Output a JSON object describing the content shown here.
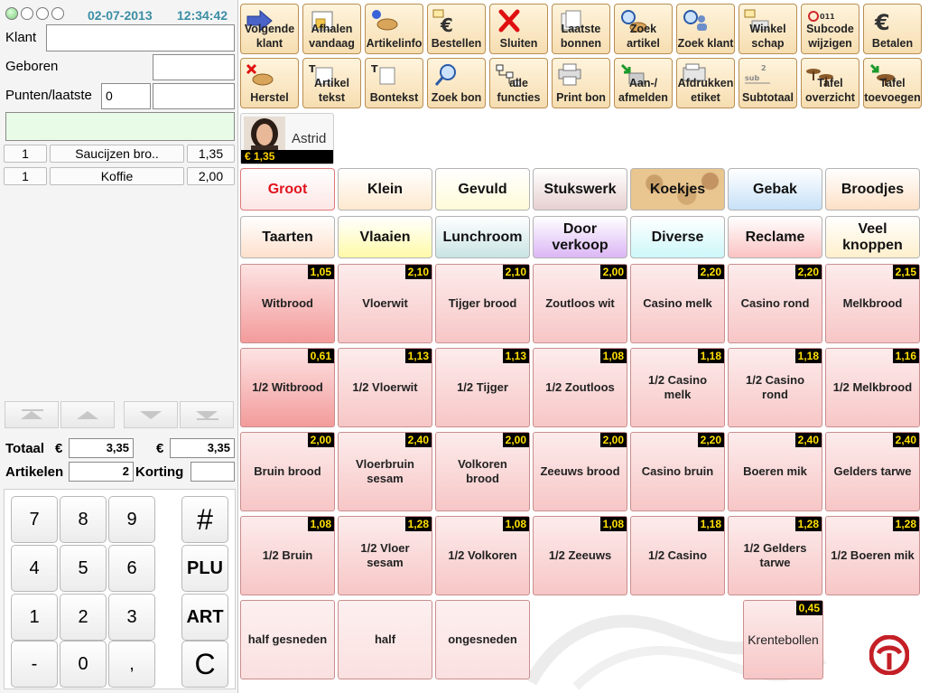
{
  "header": {
    "date": "02-07-2013",
    "time": "12:34:42"
  },
  "customer": {
    "klant_label": "Klant",
    "klant_value": "",
    "geboren_label": "Geboren",
    "geboren_value": "",
    "punten_label": "Punten/laatste",
    "punten_value": "0",
    "laatste_value": "",
    "note_value": ""
  },
  "order_lines": [
    {
      "qty": "1",
      "name": "Saucijzen bro..",
      "price": "1,35"
    },
    {
      "qty": "1",
      "name": "Koffie",
      "price": "2,00"
    }
  ],
  "totals": {
    "totaal_label": "Totaal",
    "currency": "€",
    "totaal_value": "3,35",
    "currency2": "€",
    "totaal2_value": "3,35",
    "artikelen_label": "Artikelen",
    "artikelen_value": "2",
    "korting_label": "Korting",
    "korting_value": ""
  },
  "keypad": [
    "7",
    "8",
    "9",
    "#",
    "4",
    "5",
    "6",
    "PLU",
    "1",
    "2",
    "3",
    "ART",
    "-",
    "0",
    ",",
    "C"
  ],
  "toolbar_row1": [
    {
      "label": "Volgende klant",
      "icon": "arrow-right-icon"
    },
    {
      "label": "Afhalen vandaag",
      "icon": "bag-calendar-icon"
    },
    {
      "label": "Artikelinfo",
      "icon": "info-bread-icon"
    },
    {
      "label": "Bestellen",
      "icon": "euro-mail-icon"
    },
    {
      "label": "Sluiten",
      "icon": "close-x-icon"
    },
    {
      "label": "Laatste bonnen",
      "icon": "receipts-icon"
    },
    {
      "label": "Zoek artikel",
      "icon": "search-bread-icon"
    },
    {
      "label": "Zoek klant",
      "icon": "search-person-icon"
    },
    {
      "label": "Winkel schap",
      "icon": "shelf-mail-icon"
    },
    {
      "label": "Subcode wijzigen",
      "icon": "subcode-icon"
    },
    {
      "label": "Betalen",
      "icon": "euro-icon"
    }
  ],
  "toolbar_row2": [
    {
      "label": "Herstel",
      "icon": "undo-bread-icon"
    },
    {
      "label": "Artikel tekst",
      "icon": "text-edit-icon"
    },
    {
      "label": "Bontekst",
      "icon": "receipt-text-icon"
    },
    {
      "label": "Zoek bon",
      "icon": "search-receipt-icon"
    },
    {
      "label": "alle functies",
      "icon": "tree-icon"
    },
    {
      "label": "Print bon",
      "icon": "printer-icon"
    },
    {
      "label": "Aan-/ afmelden",
      "icon": "login-icon"
    },
    {
      "label": "Afdrukken etiket",
      "icon": "label-printer-icon"
    },
    {
      "label": "Subtotaal",
      "icon": "subtotal-icon"
    },
    {
      "label": "Tafel overzicht",
      "icon": "tables-icon"
    },
    {
      "label": "Tafel toevoegen",
      "icon": "table-add-icon"
    }
  ],
  "user": {
    "name": "Astrid",
    "amount": "€ 1,35"
  },
  "categories": [
    {
      "label": "Groot",
      "bg": "#fde6e6",
      "color": "#e0141e",
      "active": true
    },
    {
      "label": "Klein",
      "bg": "#fde9cf",
      "color": "#111111"
    },
    {
      "label": "Gevuld",
      "bg": "#fffbd8",
      "color": "#111111"
    },
    {
      "label": "Stukswerk",
      "bg": "#e7d0d0",
      "color": "#111111"
    },
    {
      "label": "Koekjes",
      "bg": "#e9c58f",
      "color": "#111111"
    },
    {
      "label": "Gebak",
      "bg": "#c7e1f7",
      "color": "#111111"
    },
    {
      "label": "Broodjes",
      "bg": "#fde0c6",
      "color": "#111111"
    },
    {
      "label": "Taarten",
      "bg": "#fde0cc",
      "color": "#111111"
    },
    {
      "label": "Vlaaien",
      "bg": "#fffaa8",
      "color": "#111111"
    },
    {
      "label": "Lunchroom",
      "bg": "#c8e4e3",
      "color": "#111111"
    },
    {
      "label": "Door verkoop",
      "bg": "#dbb6f5",
      "color": "#111111"
    },
    {
      "label": "Diverse",
      "bg": "#cdf7f9",
      "color": "#111111"
    },
    {
      "label": "Reclame",
      "bg": "#fbc2c2",
      "color": "#111111"
    },
    {
      "label": "Veel knoppen",
      "bg": "#fff0cc",
      "color": "#111111"
    }
  ],
  "articles": [
    [
      {
        "name": "Witbrood",
        "price": "1,05",
        "selected": true
      },
      {
        "name": "Vloerwit",
        "price": "2,10"
      },
      {
        "name": "Tijger brood",
        "price": "2,10"
      },
      {
        "name": "Zoutloos wit",
        "price": "2,00"
      },
      {
        "name": "Casino melk",
        "price": "2,20"
      },
      {
        "name": "Casino rond",
        "price": "2,20"
      },
      {
        "name": "Melkbrood",
        "price": "2,15"
      }
    ],
    [
      {
        "name": "1/2 Witbrood",
        "price": "0,61",
        "selected": true
      },
      {
        "name": "1/2 Vloerwit",
        "price": "1,13"
      },
      {
        "name": "1/2 Tijger",
        "price": "1,13"
      },
      {
        "name": "1/2 Zoutloos",
        "price": "1,08"
      },
      {
        "name": "1/2 Casino melk",
        "price": "1,18"
      },
      {
        "name": "1/2 Casino rond",
        "price": "1,18"
      },
      {
        "name": "1/2 Melkbrood",
        "price": "1,16"
      }
    ],
    [
      {
        "name": "Bruin brood",
        "price": "2,00"
      },
      {
        "name": "Vloerbruin sesam",
        "price": "2,40"
      },
      {
        "name": "Volkoren brood",
        "price": "2,00"
      },
      {
        "name": "Zeeuws brood",
        "price": "2,00"
      },
      {
        "name": "Casino bruin",
        "price": "2,20"
      },
      {
        "name": "Boeren mik",
        "price": "2,40"
      },
      {
        "name": "Gelders tarwe",
        "price": "2,40"
      }
    ],
    [
      {
        "name": "1/2 Bruin",
        "price": "1,08"
      },
      {
        "name": "1/2 Vloer sesam",
        "price": "1,28"
      },
      {
        "name": "1/2 Volkoren",
        "price": "1,08"
      },
      {
        "name": "1/2 Zeeuws",
        "price": "1,08"
      },
      {
        "name": "1/2 Casino",
        "price": "1,18"
      },
      {
        "name": "1/2 Gelders tarwe",
        "price": "1,28"
      },
      {
        "name": "1/2 Boeren mik",
        "price": "1,28"
      }
    ]
  ],
  "slicing": [
    {
      "name": "half gesneden"
    },
    {
      "name": "half"
    },
    {
      "name": "ongesneden"
    }
  ],
  "extra_article": {
    "name": "Krentebollen",
    "price": "0,45"
  }
}
